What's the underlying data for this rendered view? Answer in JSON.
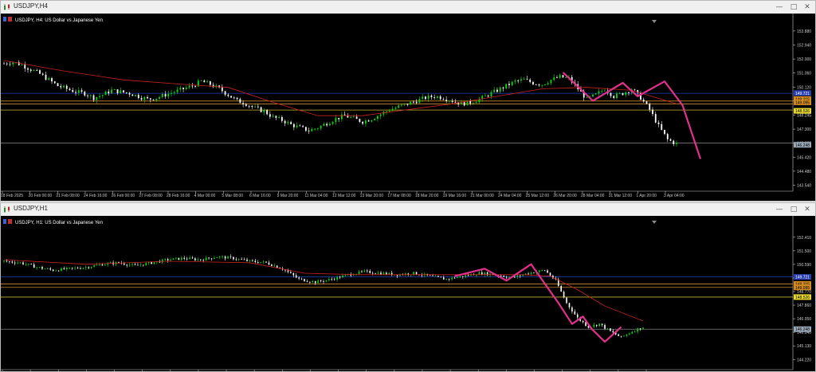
{
  "windows": [
    {
      "title": "USDJPY,H4",
      "header": "USDJPY, H4:  US Dollar vs Japanese Yen",
      "price_ticks": [
        "153.880",
        "152.940",
        "152.000",
        "151.060",
        "150.120",
        "149.185",
        "148.245",
        "147.300",
        "146.360",
        "145.420",
        "144.480",
        "143.540"
      ],
      "hlines": [
        {
          "price": 149.7,
          "color": "#1f3fbf"
        },
        {
          "price": 149.185,
          "color": "#c88a2e"
        },
        {
          "price": 148.99,
          "color": "#c88a2e"
        },
        {
          "price": 148.58,
          "color": "#c8b42e"
        },
        {
          "price": 146.36,
          "color": "#7f7f7f"
        }
      ],
      "price_labels": [
        {
          "text": "149.721",
          "price": 149.72,
          "bg": "#2a3fb0",
          "fg": "#ffffff"
        },
        {
          "text": "149.315",
          "price": 149.315,
          "bg": "#d08a20",
          "fg": "#000000"
        },
        {
          "text": "149.095",
          "price": 149.095,
          "bg": "#d08a20",
          "fg": "#000000"
        },
        {
          "text": "148.526",
          "price": 148.526,
          "bg": "#e8d830",
          "fg": "#000000"
        },
        {
          "text": "146.248",
          "price": 146.248,
          "bg": "#9aaab8",
          "fg": "#000000"
        }
      ],
      "time_labels": [
        "18 Feb 2025",
        "20 Feb 00:00",
        "21 Feb 08:00",
        "24 Feb 16:00",
        "26 Feb 00:00",
        "27 Feb 08:00",
        "28 Feb 16:00",
        "4 Mar 00:00",
        "5 Mar 08:00",
        "6 Mar 16:00",
        "9 Mar 20:00",
        "11 Mar 04:00",
        "12 Mar 12:00",
        "13 Mar 20:00",
        "17 Mar 08:00",
        "18 Mar 20:00",
        "19 Mar 16:00",
        "21 Mar 00:00",
        "24 Mar 04:00",
        "25 Mar 12:00",
        "26 Mar 20:00",
        "28 Mar 04:00",
        "31 Mar 12:00",
        "1 Apr 20:00",
        "3 Apr 04:00"
      ]
    },
    {
      "title": "USDJPY,H1",
      "header": "USDJPY, H1:  US Dollar vs Japanese Yen",
      "price_ticks": [
        "152.410",
        "151.500",
        "150.590",
        "149.680",
        "148.770",
        "147.860",
        "146.950",
        "146.040",
        "145.130",
        "144.220"
      ],
      "hlines": [
        {
          "price": 149.75,
          "color": "#1f3fbf"
        },
        {
          "price": 149.28,
          "color": "#c88a2e"
        },
        {
          "price": 149.05,
          "color": "#c88a2e"
        },
        {
          "price": 148.4,
          "color": "#c8b42e"
        },
        {
          "price": 146.25,
          "color": "#7f7f7f"
        }
      ],
      "price_labels": [
        {
          "text": "149.721",
          "price": 149.75,
          "bg": "#2a3fb0",
          "fg": "#ffffff"
        },
        {
          "text": "149.315",
          "price": 149.28,
          "bg": "#d08a20",
          "fg": "#000000"
        },
        {
          "text": "149.095",
          "price": 149.05,
          "bg": "#d08a20",
          "fg": "#000000"
        },
        {
          "text": "148.526",
          "price": 148.4,
          "bg": "#e8d830",
          "fg": "#000000"
        },
        {
          "text": "146.248",
          "price": 146.25,
          "bg": "#9aaab8",
          "fg": "#000000"
        }
      ],
      "time_labels": [
        "24 Mar 2025",
        "25 Mar 12:00",
        "25 Mar 20:00",
        "26 Mar 04:00",
        "26 Mar 12:00",
        "26 Mar 20:00",
        "27 Mar 04:00",
        "27 Mar 12:00",
        "27 Mar 20:00",
        "28 Mar 04:00",
        "28 Mar 12:00",
        "28 Mar 20:00",
        "31 Mar 05:00",
        "31 Mar 13:00",
        "31 Mar 21:00",
        "1 Apr 05:00",
        "1 Apr 13:00",
        "1 Apr 21:00",
        "2 Apr 05:00",
        "2 Apr 13:00",
        "2 Apr 21:00",
        "3 Apr 05:00",
        "3 Apr 13:00",
        "3 Apr 21:00"
      ]
    }
  ],
  "colors": {
    "bull": "#00e000",
    "bear": "#ffffff",
    "ma": "#cc2020",
    "zigzag": "#e0308a",
    "axis_text": "#c8c8c8",
    "header_text": "#ffffff"
  },
  "icons": {
    "window": "candlestick-chart-icon",
    "minimize": "minimize-icon",
    "maximize": "maximize-icon",
    "close": "close-icon"
  },
  "chart_data": [
    {
      "type": "candlestick",
      "symbol": "USDJPY",
      "timeframe": "H4",
      "ylim": [
        143.3,
        154.3
      ],
      "close_path": [
        [
          0,
          151.7
        ],
        [
          3,
          151.8
        ],
        [
          6,
          151.6
        ],
        [
          9,
          151.3
        ],
        [
          12,
          151.0
        ],
        [
          15,
          150.6
        ],
        [
          18,
          150.2
        ],
        [
          21,
          150.0
        ],
        [
          24,
          149.8
        ],
        [
          27,
          149.7
        ],
        [
          30,
          149.4
        ],
        [
          33,
          149.6
        ],
        [
          36,
          149.9
        ],
        [
          39,
          149.8
        ],
        [
          42,
          149.7
        ],
        [
          45,
          149.5
        ],
        [
          48,
          149.3
        ],
        [
          51,
          149.4
        ],
        [
          54,
          149.6
        ],
        [
          57,
          149.8
        ],
        [
          60,
          150.0
        ],
        [
          63,
          150.2
        ],
        [
          66,
          150.5
        ],
        [
          69,
          150.3
        ],
        [
          72,
          150.0
        ],
        [
          75,
          149.6
        ],
        [
          78,
          149.2
        ],
        [
          81,
          149.0
        ],
        [
          84,
          148.7
        ],
        [
          87,
          148.5
        ],
        [
          90,
          148.1
        ],
        [
          93,
          147.9
        ],
        [
          96,
          147.6
        ],
        [
          99,
          147.4
        ],
        [
          102,
          147.2
        ],
        [
          105,
          147.4
        ],
        [
          108,
          147.7
        ],
        [
          111,
          148.0
        ],
        [
          114,
          148.2
        ],
        [
          117,
          148.0
        ],
        [
          120,
          147.8
        ],
        [
          123,
          148.0
        ],
        [
          126,
          148.3
        ],
        [
          129,
          148.6
        ],
        [
          132,
          148.8
        ],
        [
          135,
          149.0
        ],
        [
          138,
          149.2
        ],
        [
          141,
          149.4
        ],
        [
          144,
          149.5
        ],
        [
          147,
          149.4
        ],
        [
          150,
          149.2
        ],
        [
          153,
          149.0
        ],
        [
          156,
          149.1
        ],
        [
          159,
          149.3
        ],
        [
          162,
          149.6
        ],
        [
          165,
          149.9
        ],
        [
          168,
          150.2
        ],
        [
          171,
          150.5
        ],
        [
          174,
          150.6
        ],
        [
          177,
          150.4
        ],
        [
          180,
          150.3
        ],
        [
          183,
          150.6
        ],
        [
          186,
          150.8
        ],
        [
          189,
          150.7
        ],
        [
          192,
          150.0
        ],
        [
          195,
          149.3
        ],
        [
          198,
          149.6
        ],
        [
          201,
          150.0
        ],
        [
          204,
          149.5
        ],
        [
          207,
          149.7
        ],
        [
          210,
          150.0
        ],
        [
          213,
          149.4
        ],
        [
          216,
          148.6
        ],
        [
          219,
          147.5
        ],
        [
          222,
          146.6
        ],
        [
          225,
          146.3
        ]
      ],
      "moving_average": [
        [
          0,
          151.9
        ],
        [
          20,
          151.2
        ],
        [
          40,
          150.6
        ],
        [
          60,
          150.3
        ],
        [
          75,
          150.1
        ],
        [
          90,
          149.1
        ],
        [
          105,
          148.2
        ],
        [
          120,
          148.2
        ],
        [
          135,
          148.6
        ],
        [
          150,
          149.0
        ],
        [
          165,
          149.5
        ],
        [
          180,
          150.0
        ],
        [
          195,
          150.1
        ],
        [
          210,
          149.9
        ],
        [
          225,
          149.0
        ]
      ],
      "zigzag": [
        [
          187,
          151.1
        ],
        [
          197,
          149.2
        ],
        [
          207,
          150.4
        ],
        [
          212,
          149.5
        ],
        [
          221,
          150.5
        ],
        [
          227,
          148.9
        ],
        [
          233,
          145.3
        ]
      ]
    },
    {
      "type": "candlestick",
      "symbol": "USDJPY",
      "timeframe": "H1",
      "ylim": [
        143.7,
        153.2
      ],
      "close_path": [
        [
          0,
          150.8
        ],
        [
          6,
          150.7
        ],
        [
          12,
          150.4
        ],
        [
          18,
          150.2
        ],
        [
          24,
          150.3
        ],
        [
          30,
          150.4
        ],
        [
          36,
          150.6
        ],
        [
          42,
          150.7
        ],
        [
          48,
          150.5
        ],
        [
          54,
          150.7
        ],
        [
          60,
          150.9
        ],
        [
          66,
          151.0
        ],
        [
          72,
          150.9
        ],
        [
          78,
          151.1
        ],
        [
          84,
          151.0
        ],
        [
          90,
          150.8
        ],
        [
          96,
          150.7
        ],
        [
          102,
          150.3
        ],
        [
          108,
          149.6
        ],
        [
          114,
          149.4
        ],
        [
          120,
          149.6
        ],
        [
          126,
          149.9
        ],
        [
          132,
          150.1
        ],
        [
          138,
          150.0
        ],
        [
          144,
          149.9
        ],
        [
          150,
          150.0
        ],
        [
          156,
          149.8
        ],
        [
          162,
          149.6
        ],
        [
          168,
          149.8
        ],
        [
          174,
          150.0
        ],
        [
          180,
          149.9
        ],
        [
          186,
          149.7
        ],
        [
          192,
          150.0
        ],
        [
          198,
          150.2
        ],
        [
          202,
          149.5
        ],
        [
          206,
          148.0
        ],
        [
          210,
          147.0
        ],
        [
          214,
          146.4
        ],
        [
          218,
          146.6
        ],
        [
          222,
          146.1
        ],
        [
          226,
          145.7
        ],
        [
          230,
          146.1
        ],
        [
          234,
          146.4
        ]
      ],
      "moving_average": [
        [
          0,
          150.9
        ],
        [
          30,
          150.6
        ],
        [
          60,
          150.8
        ],
        [
          90,
          150.7
        ],
        [
          110,
          150.0
        ],
        [
          130,
          149.9
        ],
        [
          150,
          149.9
        ],
        [
          170,
          149.9
        ],
        [
          190,
          149.9
        ],
        [
          200,
          149.8
        ],
        [
          210,
          148.9
        ],
        [
          220,
          147.8
        ],
        [
          234,
          146.8
        ]
      ],
      "zigzag": [
        [
          165,
          149.8
        ],
        [
          176,
          150.3
        ],
        [
          184,
          149.5
        ],
        [
          193,
          150.6
        ],
        [
          203,
          148.0
        ],
        [
          208,
          146.6
        ],
        [
          212,
          147.1
        ],
        [
          215,
          146.3
        ],
        [
          220,
          145.4
        ],
        [
          226,
          146.4
        ]
      ]
    }
  ]
}
